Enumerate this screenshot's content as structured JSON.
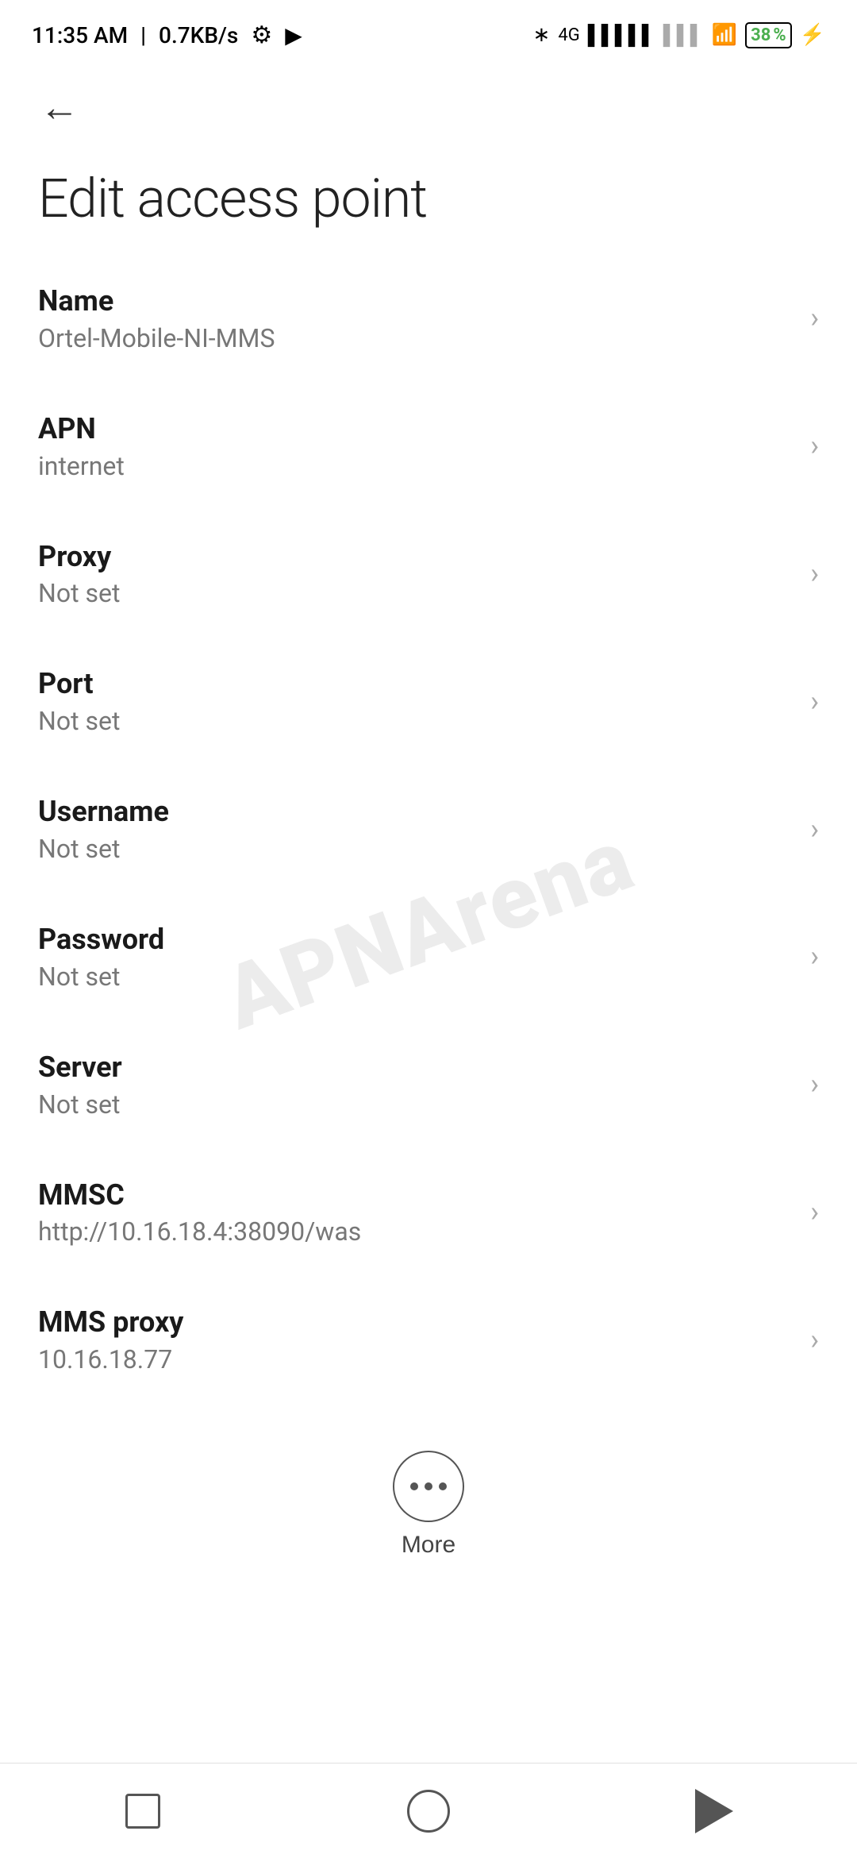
{
  "statusBar": {
    "time": "11:35 AM",
    "speed": "0.7KB/s",
    "battery": "38"
  },
  "nav": {
    "back_label": "←"
  },
  "page": {
    "title": "Edit access point"
  },
  "settings": [
    {
      "id": "name",
      "title": "Name",
      "value": "Ortel-Mobile-NI-MMS"
    },
    {
      "id": "apn",
      "title": "APN",
      "value": "internet"
    },
    {
      "id": "proxy",
      "title": "Proxy",
      "value": "Not set"
    },
    {
      "id": "port",
      "title": "Port",
      "value": "Not set"
    },
    {
      "id": "username",
      "title": "Username",
      "value": "Not set"
    },
    {
      "id": "password",
      "title": "Password",
      "value": "Not set"
    },
    {
      "id": "server",
      "title": "Server",
      "value": "Not set"
    },
    {
      "id": "mmsc",
      "title": "MMSC",
      "value": "http://10.16.18.4:38090/was"
    },
    {
      "id": "mms-proxy",
      "title": "MMS proxy",
      "value": "10.16.18.77"
    }
  ],
  "more": {
    "label": "More"
  },
  "watermark": {
    "text": "APNArena"
  }
}
